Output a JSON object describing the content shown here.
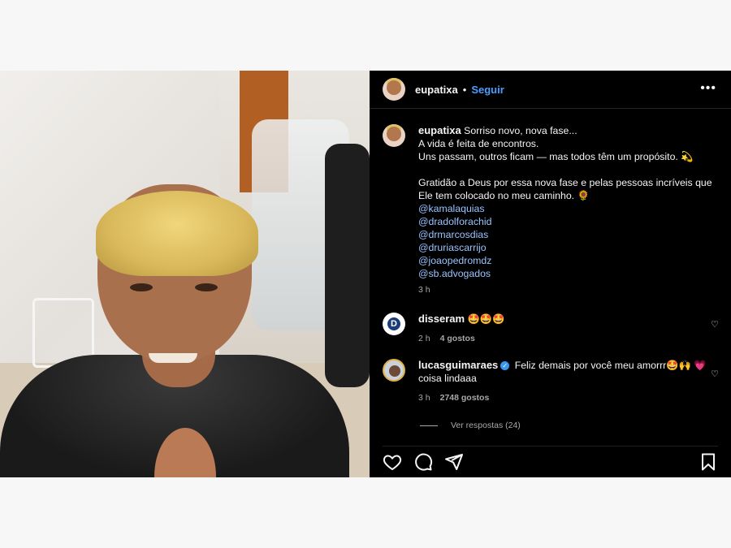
{
  "post": {
    "username": "eupatixa",
    "follow_label": "Seguir",
    "more_icon": "more-icon",
    "caption": {
      "username": "eupatixa",
      "line1": "Sorriso novo, nova fase...",
      "line2": "A vida é feita de encontros.",
      "line3": "Uns passam, outros ficam — mas todos têm um propósito. 💫",
      "line4": "Gratidão a Deus por essa nova fase e pelas pessoas incríveis que",
      "line5": "Ele tem colocado no meu caminho. 🌻",
      "mentions": [
        "@kamalaquias",
        "@dradolforachid",
        "@drmarcosdias",
        "@druriascarrijo",
        "@joaopedromdz",
        "@sb.advogados"
      ],
      "time": "3 h"
    },
    "comments": [
      {
        "username": "disseram",
        "text": "🤩🤩🤩",
        "time": "2 h",
        "likes": "4 gostos"
      },
      {
        "username": "lucasguimaraes",
        "text": "Feliz demais por você meu amorrr🤩🙌 💗",
        "text2": "coisa lindaaa",
        "time": "3 h",
        "likes": "2748 gostos"
      }
    ],
    "replies_label": "Ver respostas (24)"
  },
  "colors": {
    "panel_bg": "#000000",
    "link": "#4c9eff",
    "mention": "#9ac4ff"
  }
}
